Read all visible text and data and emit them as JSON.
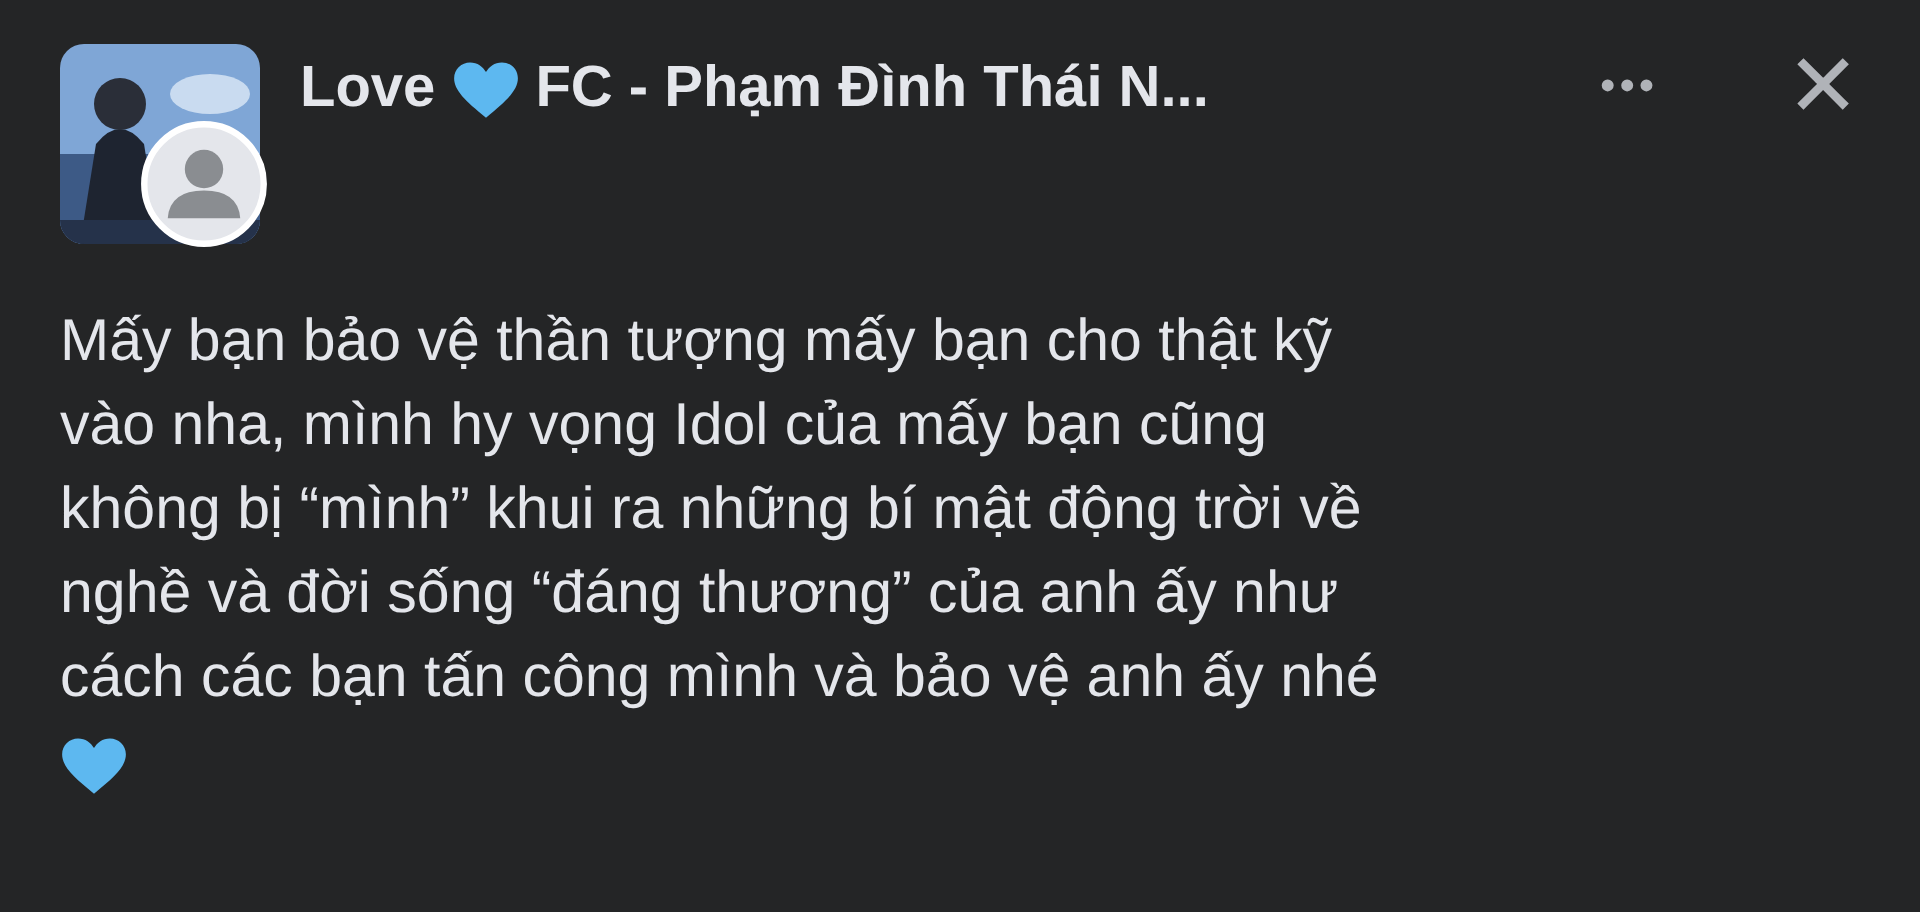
{
  "header": {
    "title_parts": [
      "Love",
      "FC - Phạm Đình Thái N..."
    ],
    "more": "•••",
    "close": "✕"
  },
  "post": {
    "lines": [
      "Mấy bạn bảo vệ thần tượng mấy bạn cho thật kỹ",
      "vào nha, mình hy vọng Idol của mấy bạn cũng",
      "không bị “mình” khui ra những bí mật động trời về",
      "nghề và đời sống “đáng thương” của anh ấy như",
      "cách các bạn tấn công mình và bảo vệ anh ấy nhé"
    ]
  }
}
